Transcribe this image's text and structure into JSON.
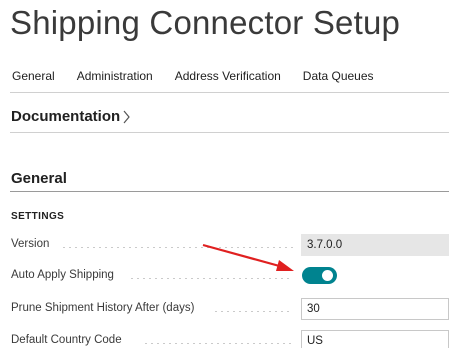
{
  "page": {
    "title": "Shipping Connector Setup"
  },
  "menu": [
    "General",
    "Administration",
    "Address Verification",
    "Data Queues"
  ],
  "documentation": {
    "label": "Documentation"
  },
  "section": {
    "title": "General",
    "group": "SETTINGS"
  },
  "fields": {
    "version": {
      "label": "Version",
      "value": "3.7.0.0"
    },
    "auto_apply_shipping": {
      "label": "Auto Apply Shipping",
      "enabled": true
    },
    "prune_history": {
      "label": "Prune Shipment History After (days)",
      "value": "30"
    },
    "default_country": {
      "label": "Default Country Code",
      "value": "US"
    }
  },
  "colors": {
    "toggle_on": "#00838f",
    "annotation_arrow": "#e02020"
  }
}
